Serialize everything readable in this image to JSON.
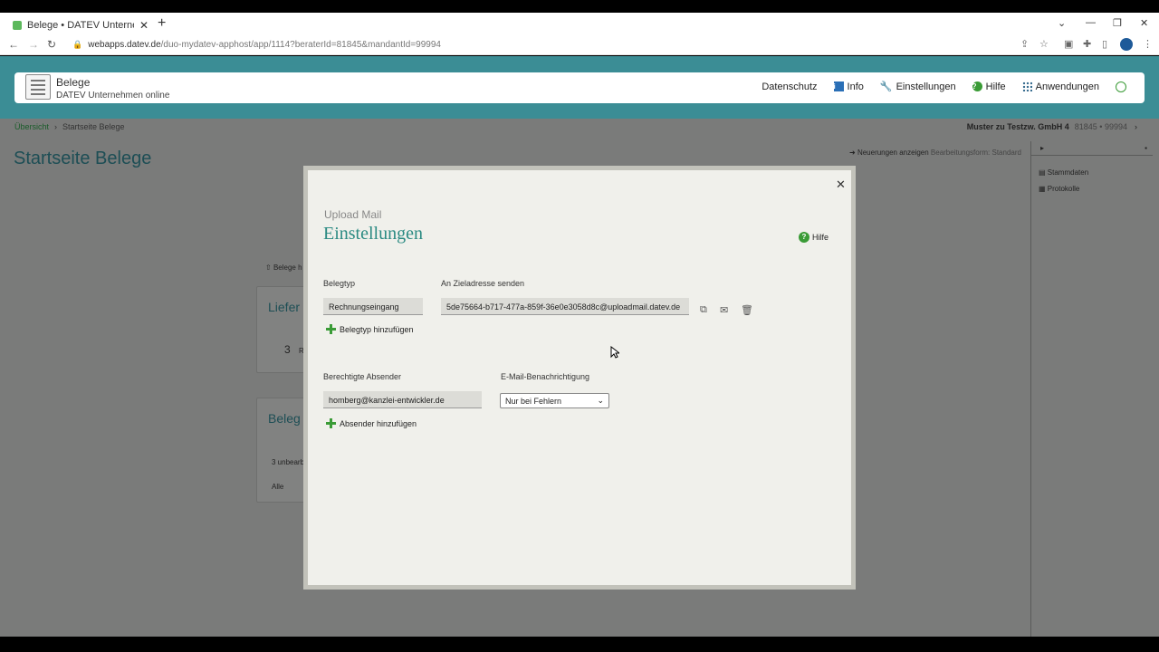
{
  "browser": {
    "tab_title": "Belege • DATEV Unternehmen on",
    "url_host": "webapps.datev.de",
    "url_path": "/duo-mydatev-apphost/app/1114?beraterId=81845&mandantId=99994"
  },
  "header": {
    "app_title": "Belege",
    "app_subtitle": "DATEV Unternehmen online",
    "nav": {
      "datenschutz": "Datenschutz",
      "info": "Info",
      "einstellungen": "Einstellungen",
      "hilfe": "Hilfe",
      "anwendungen": "Anwendungen"
    }
  },
  "breadcrumb": {
    "root": "Übersicht",
    "current": "Startseite Belege"
  },
  "client": {
    "name": "Muster zu Testzw. GmbH 4",
    "numbers": "81845 • 99994"
  },
  "page": {
    "title": "Startseite Belege",
    "news_link": "Neuerungen anzeigen",
    "edit_form": "Bearbeitungsform: Standard"
  },
  "sidepanel": {
    "items": [
      "Stammdaten",
      "Protokolle"
    ]
  },
  "background_cards": {
    "card1_prefix": "Belege h",
    "card2_title": "Liefer",
    "card2_count": "3",
    "card2_suffix": "R",
    "card3_title": "Beleg",
    "card3_line": "3 unbearb",
    "card3_filter": "Alle"
  },
  "modal": {
    "subtitle": "Upload Mail",
    "title": "Einstellungen",
    "help": "Hilfe",
    "belegtyp_label": "Belegtyp",
    "belegtyp_value": "Rechnungseingang",
    "zieladresse_label": "An Zieladresse senden",
    "zieladresse_value": "5de75664-b717-477a-859f-36e0e3058d8c@uploadmail.datev.de",
    "add_belegtyp": "Belegtyp hinzufügen",
    "absender_label": "Berechtigte Absender",
    "absender_value": "homberg@kanzlei-entwickler.de",
    "benachrichtigung_label": "E-Mail-Benachrichtigung",
    "benachrichtigung_value": "Nur bei Fehlern",
    "add_absender": "Absender hinzufügen"
  }
}
